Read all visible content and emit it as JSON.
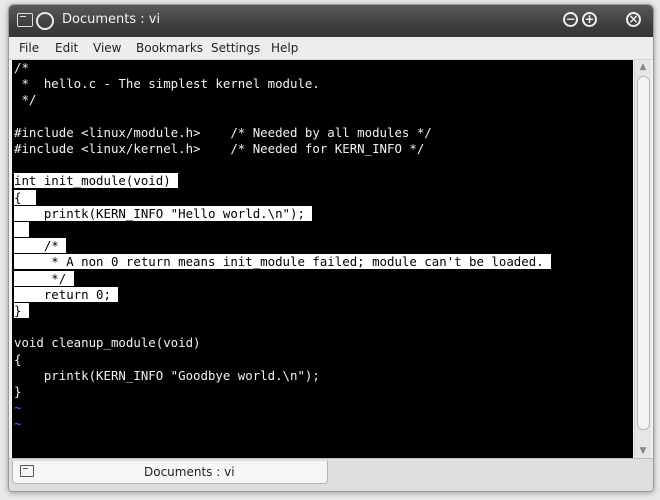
{
  "window": {
    "title": "Documents : vi"
  },
  "titlebar_buttons": {
    "minimize": "−",
    "maximize": "+",
    "close": "×"
  },
  "menu": [
    "File",
    "Edit",
    "View",
    "Bookmarks",
    "Settings",
    "Help"
  ],
  "terminal": {
    "lines": [
      {
        "text": "/*",
        "selected": false
      },
      {
        "text": " *  hello.c - The simplest kernel module.",
        "selected": false
      },
      {
        "text": " */",
        "selected": false
      },
      {
        "text": "",
        "selected": false
      },
      {
        "text": "#include <linux/module.h>    /* Needed by all modules */",
        "selected": false
      },
      {
        "text": "#include <linux/kernel.h>    /* Needed for KERN_INFO */",
        "selected": false
      },
      {
        "text": "",
        "selected": false
      },
      {
        "text": "int init_module(void) ",
        "selected": true
      },
      {
        "text": "{  ",
        "selected": true
      },
      {
        "text": "    printk(KERN_INFO \"Hello world.\\n\"); ",
        "selected": true
      },
      {
        "text": "  ",
        "selected": true
      },
      {
        "text": "    /* ",
        "selected": true
      },
      {
        "text": "     * A non 0 return means init_module failed; module can't be loaded. ",
        "selected": true
      },
      {
        "text": "     */ ",
        "selected": true
      },
      {
        "text": "    return 0; ",
        "selected": true
      },
      {
        "text": "} ",
        "selected": true
      },
      {
        "text": "",
        "selected": false
      },
      {
        "text": "void cleanup_module(void)",
        "selected": false
      },
      {
        "text": "{",
        "selected": false
      },
      {
        "text": "    printk(KERN_INFO \"Goodbye world.\\n\");",
        "selected": false
      },
      {
        "text": "}",
        "selected": false
      },
      {
        "text": "~",
        "selected": false,
        "tilde": true
      },
      {
        "text": "~",
        "selected": false,
        "tilde": true
      }
    ]
  },
  "tab": {
    "label": "Documents : vi"
  }
}
